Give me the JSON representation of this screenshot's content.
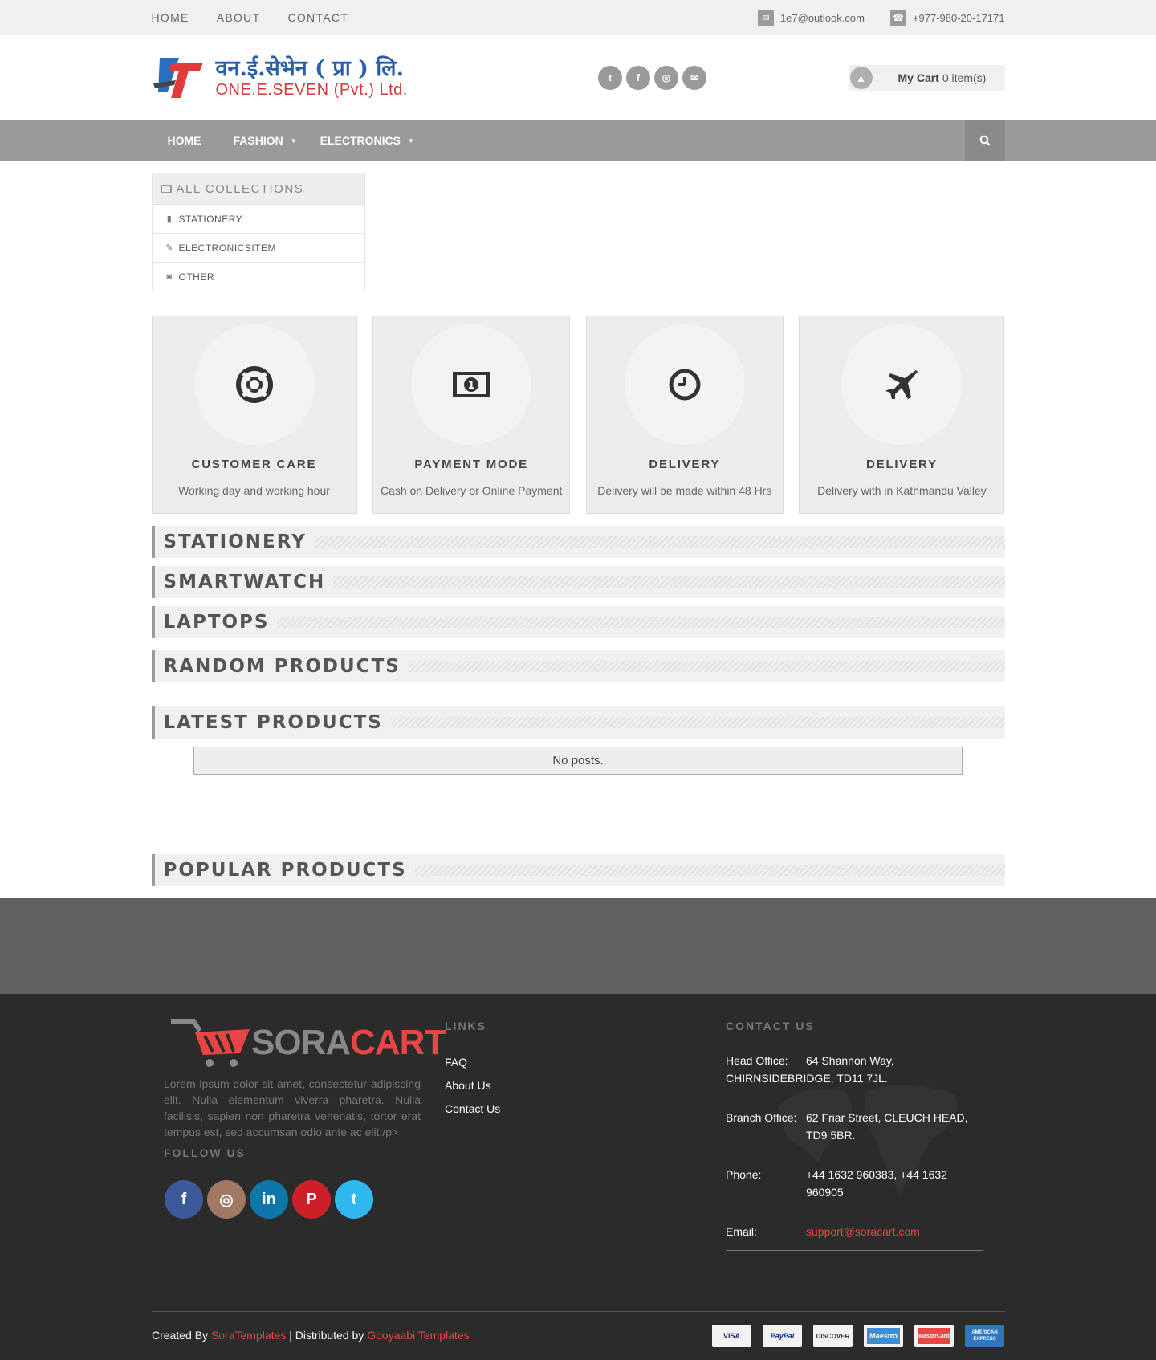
{
  "topbar": {
    "nav": [
      "HOME",
      "ABOUT",
      "CONTACT"
    ],
    "email": "1e7@outlook.com",
    "phone": "+977-980-20-17171"
  },
  "header": {
    "logo_line1": "वन.ई.सेभेन ( प्रा ) लि.",
    "logo_line2": "ONE.E.SEVEN (Pvt.) Ltd.",
    "social_icons": [
      "twitter-icon",
      "facebook-icon",
      "instagram-icon",
      "envelope-icon"
    ],
    "cart_label": "My Cart",
    "cart_count": "0 item(s)"
  },
  "mainnav": {
    "items": [
      "HOME",
      "FASHION",
      "ELECTRONICS"
    ]
  },
  "collections": {
    "title": "ALL COLLECTIONS",
    "items": [
      "STATIONERY",
      "ELECTRONICSITEM",
      "OTHER"
    ]
  },
  "features": [
    {
      "title": "CUSTOMER CARE",
      "desc": "Working day and working hour",
      "icon": "life-ring-icon"
    },
    {
      "title": "PAYMENT MODE",
      "desc": "Cash on Delivery or Online Payment",
      "icon": "money-icon"
    },
    {
      "title": "DELIVERY",
      "desc": "Delivery will be made within 48 Hrs",
      "icon": "clock-icon"
    },
    {
      "title": "DELIVERY",
      "desc": "Delivery with in Kathmandu Valley",
      "icon": "plane-icon"
    }
  ],
  "sections": {
    "stationery": "STATIONERY",
    "smartwatch": "SMARTWATCH",
    "laptops": "LAPTOPS",
    "random": "RANDOM PRODUCTS",
    "latest": "LATEST PRODUCTS",
    "no_posts": "No posts.",
    "popular": "POPULAR PRODUCTS"
  },
  "footer": {
    "brand_sora": "SORA",
    "brand_cart": "CART",
    "about": "Lorem ipsum dolor sit amet, consectetur adipiscing elit. Nulla elementum viverra pharetra. Nulla facilisis, sapien non pharetra venenatis, tortor erat tempus est, sed accumsan odio ante ac elit./p>",
    "follow_title": "FOLLOW US",
    "follow_icons": [
      "facebook-icon",
      "instagram-icon",
      "linkedin-icon",
      "pinterest-icon",
      "twitter-icon"
    ],
    "links_title": "LINKS",
    "links": [
      "FAQ",
      "About Us",
      "Contact Us"
    ],
    "contact_title": "CONTACT US",
    "contact": [
      {
        "key": "Head Office:",
        "value": "64 Shannon Way, CHIRNSIDEBRIDGE, TD11 7JL."
      },
      {
        "key": "Branch Office:",
        "value": "62 Friar Street, CLEUCH HEAD, TD9 5BR."
      },
      {
        "key": "Phone:",
        "value": "+44 1632 960383, +44 1632 960905"
      },
      {
        "key": "Email:",
        "value": "support@soracart.com"
      }
    ],
    "credits_prefix": "Created By",
    "credits_author": "SoraTemplates",
    "credits_mid": "| Distributed by",
    "credits_dist": "Gooyaabi Templates",
    "payments": [
      "VISA",
      "PayPal",
      "DISCOVER",
      "Maestro",
      "MasterCard",
      "AMERICAN EXPRESS"
    ]
  },
  "colors": {
    "accent_red": "#e84545",
    "nav_grey": "#9a9a9a",
    "footer_bg": "#2b2b2b"
  }
}
